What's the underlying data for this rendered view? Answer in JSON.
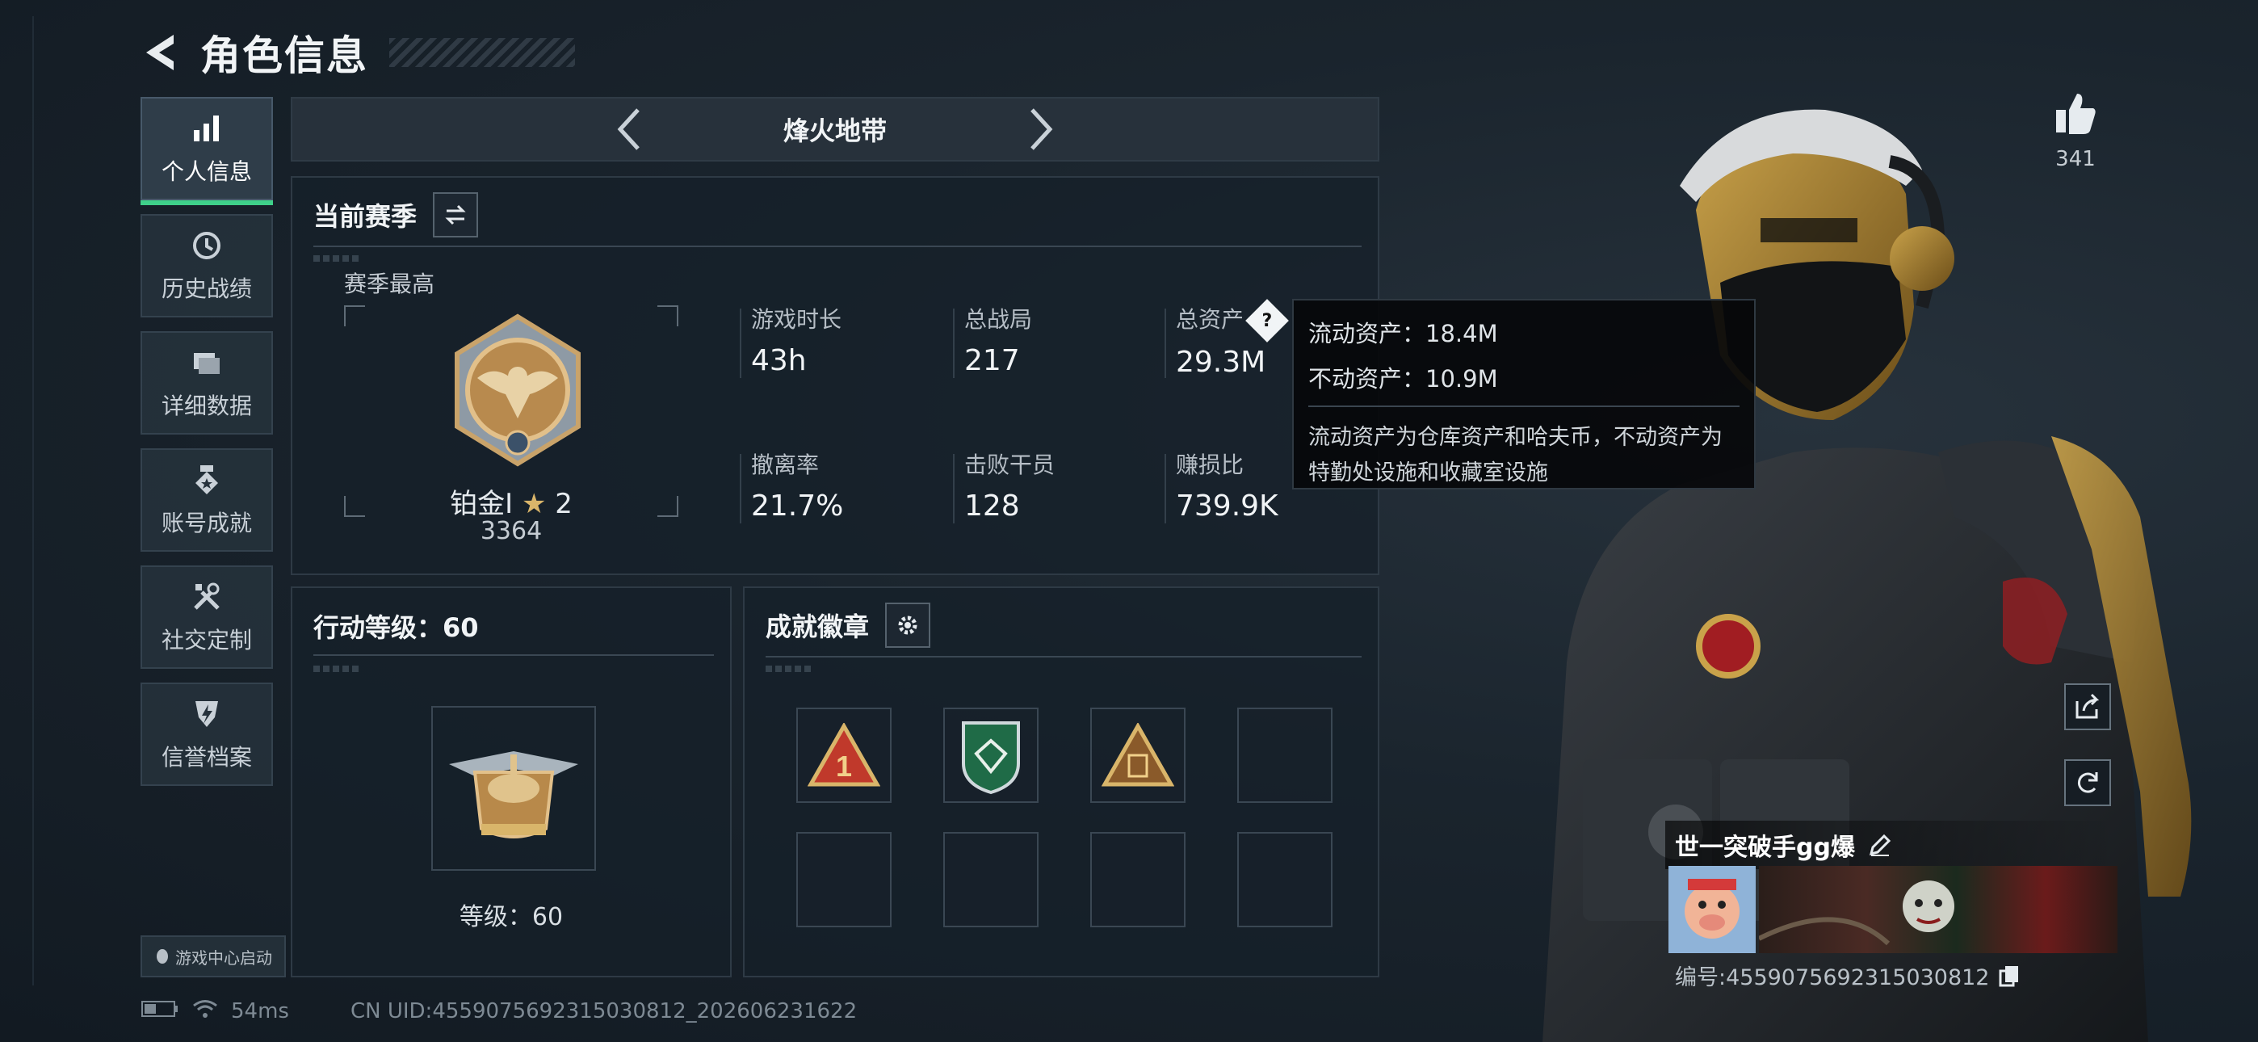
{
  "header": {
    "title": "角色信息"
  },
  "sidebar": {
    "items": [
      {
        "label": "个人信息",
        "icon": "bar-chart-icon",
        "active": true
      },
      {
        "label": "历史战绩",
        "icon": "history-icon"
      },
      {
        "label": "详细数据",
        "icon": "folder-icon"
      },
      {
        "label": "账号成就",
        "icon": "medal-icon"
      },
      {
        "label": "社交定制",
        "icon": "tools-icon"
      },
      {
        "label": "信誉档案",
        "icon": "shield-icon"
      }
    ],
    "game_center_label": "游戏中心启动"
  },
  "mode_switch": {
    "name": "烽火地带"
  },
  "season": {
    "title": "当前赛季",
    "best_label": "赛季最高",
    "rank_name": "铂金Ⅰ",
    "rank_stars": "2",
    "rank_score": "3364",
    "stats": [
      {
        "label": "游戏时长",
        "value": "43h"
      },
      {
        "label": "总战局",
        "value": "217"
      },
      {
        "label": "总资产",
        "value": "29.3M"
      },
      {
        "label": "撤离率",
        "value": "21.7%"
      },
      {
        "label": "击败干员",
        "value": "128"
      },
      {
        "label": "赚损比",
        "value": "739.9K"
      }
    ]
  },
  "tooltip": {
    "liquid": "流动资产：18.4M",
    "fixed": "不动资产：10.9M",
    "note": "流动资产为仓库资产和哈夫币，不动资产为特勤处设施和收藏室设施"
  },
  "level_panel": {
    "title": "行动等级：60",
    "level_label": "等级：60"
  },
  "achievements": {
    "title": "成就徽章",
    "slots": [
      "badge-1",
      "badge-2",
      "badge-3",
      "empty",
      "empty",
      "empty",
      "empty",
      "empty"
    ]
  },
  "profile": {
    "likes": "341",
    "player_name": "世一突破手gg爆",
    "player_id": "编号:4559075692315030812"
  },
  "status_bar": {
    "ping": "54ms",
    "uid": "CN UID:4559075692315030812_202606231622"
  },
  "colors": {
    "accent": "#3fd08a",
    "panel_border": "#2e3a45"
  }
}
